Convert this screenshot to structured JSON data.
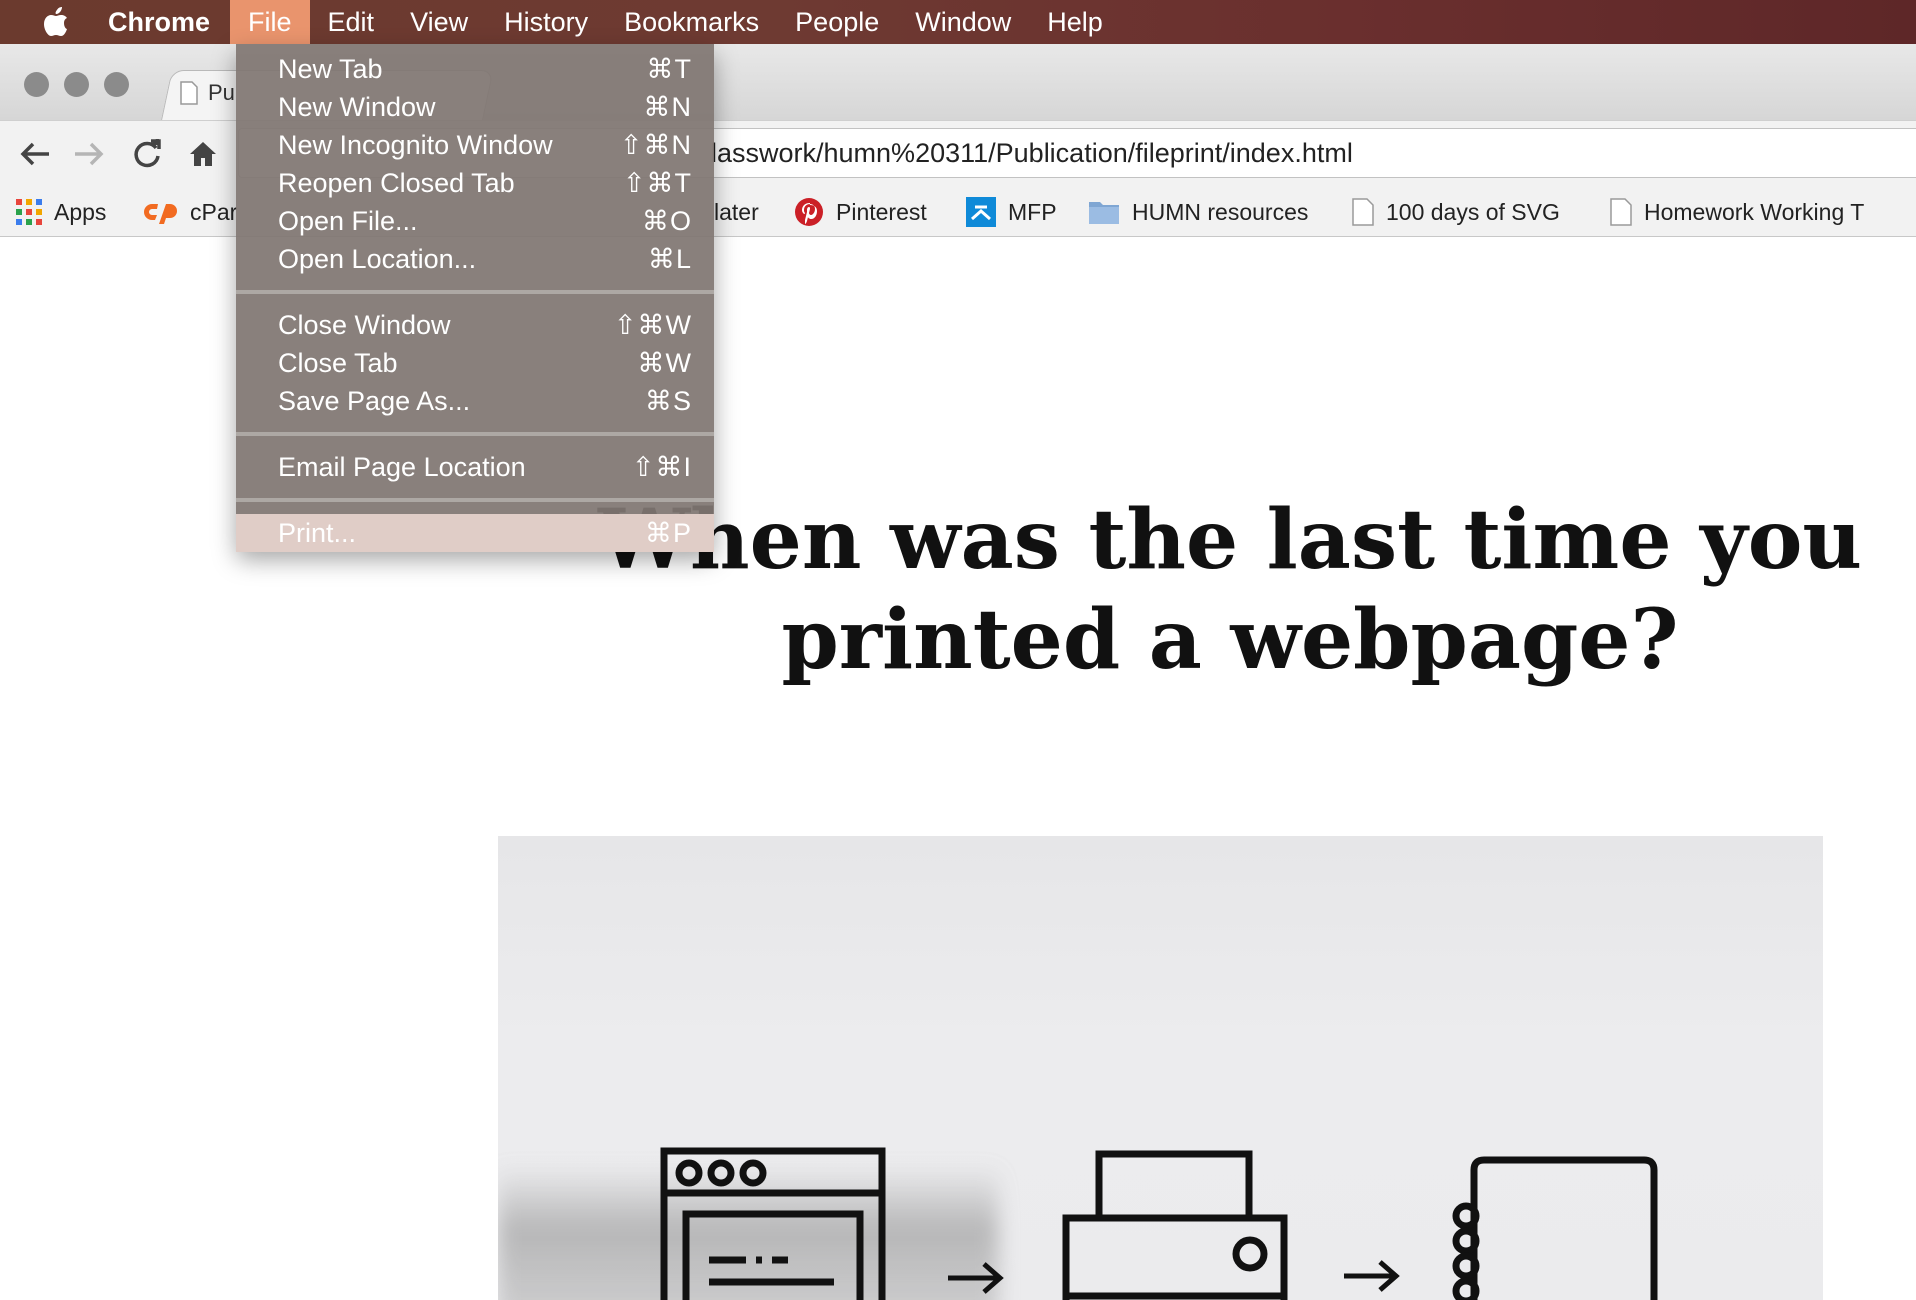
{
  "menubar": {
    "app": "Chrome",
    "items": [
      "File",
      "Edit",
      "View",
      "History",
      "Bookmarks",
      "People",
      "Window",
      "Help"
    ],
    "active": "File"
  },
  "browser": {
    "tab_title": "Pu",
    "url": "lasswork/humn%20311/Publication/fileprint/index.html"
  },
  "bookmarks": [
    {
      "label": "Apps",
      "icon": "apps-grid-icon"
    },
    {
      "label": "cPar",
      "icon": "cpanel-icon"
    },
    {
      "label": "later",
      "icon": "none"
    },
    {
      "label": "Pinterest",
      "icon": "pinterest-icon"
    },
    {
      "label": "MFP",
      "icon": "mfp-icon"
    },
    {
      "label": "HUMN resources",
      "icon": "folder-icon"
    },
    {
      "label": "100 days of SVG",
      "icon": "page-icon"
    },
    {
      "label": "Homework Working T",
      "icon": "page-icon"
    }
  ],
  "file_menu": {
    "groups": [
      [
        {
          "label": "New Tab",
          "shortcut": "⌘T"
        },
        {
          "label": "New Window",
          "shortcut": "⌘N"
        },
        {
          "label": "New Incognito Window",
          "shortcut": "⇧⌘N"
        },
        {
          "label": "Reopen Closed Tab",
          "shortcut": "⇧⌘T"
        },
        {
          "label": "Open File...",
          "shortcut": "⌘O"
        },
        {
          "label": "Open Location...",
          "shortcut": "⌘L"
        }
      ],
      [
        {
          "label": "Close Window",
          "shortcut": "⇧⌘W"
        },
        {
          "label": "Close Tab",
          "shortcut": "⌘W"
        },
        {
          "label": "Save Page As...",
          "shortcut": "⌘S"
        }
      ],
      [
        {
          "label": "Email Page Location",
          "shortcut": "⇧⌘I"
        }
      ],
      [
        {
          "label": "Print...",
          "shortcut": "⌘P",
          "highlighted": true
        }
      ]
    ]
  },
  "page": {
    "headline_line1": "When was the last time you",
    "headline_line2": "printed a webpage?"
  },
  "colors": {
    "menubar_active": "#e9946d",
    "menu_bg": "#807672",
    "menu_highlight": "#e0cdc7"
  }
}
